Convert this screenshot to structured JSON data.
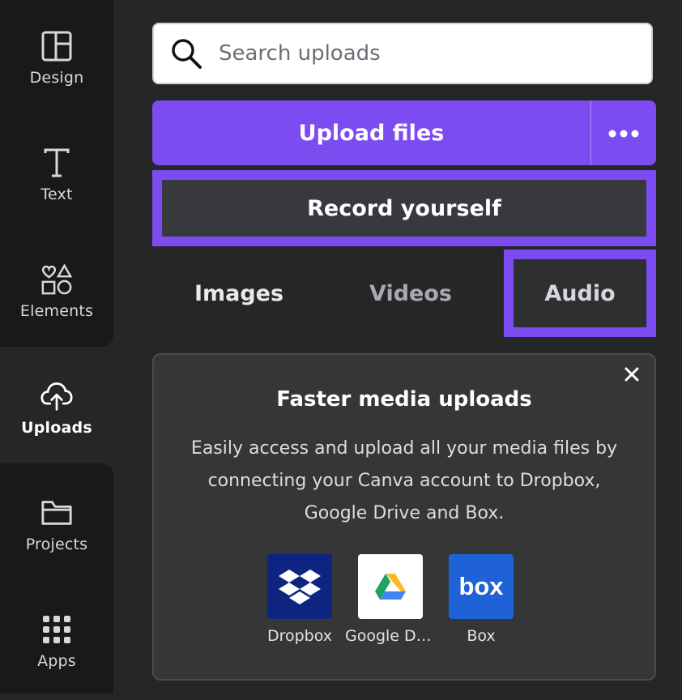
{
  "sidebar": {
    "items": [
      {
        "label": "Design",
        "icon": "layout-icon"
      },
      {
        "label": "Text",
        "icon": "text-T-icon"
      },
      {
        "label": "Elements",
        "icon": "shapes-icon"
      },
      {
        "label": "Uploads",
        "icon": "cloud-upload-icon",
        "active": true
      },
      {
        "label": "Projects",
        "icon": "folder-icon"
      },
      {
        "label": "Apps",
        "icon": "grid-apps-icon"
      }
    ]
  },
  "search": {
    "placeholder": "Search uploads",
    "value": ""
  },
  "upload": {
    "label": "Upload files",
    "more_icon": "more-dots-icon"
  },
  "record": {
    "label": "Record yourself"
  },
  "tabs": [
    {
      "label": "Images"
    },
    {
      "label": "Videos"
    },
    {
      "label": "Audio",
      "selected": true
    }
  ],
  "promo": {
    "title": "Faster media uploads",
    "body": "Easily access and upload all your media files by connecting your Canva account to Dropbox, Google Drive and Box.",
    "services": [
      {
        "name": "Dropbox",
        "color": "#0d2481"
      },
      {
        "name": "Google Drive",
        "color": "#ffffff"
      },
      {
        "name": "Box",
        "color": "#1f62d8"
      }
    ]
  },
  "colors": {
    "accent": "#7d4cf1",
    "panel_bg": "#252627",
    "rail_bg": "#18191b"
  }
}
